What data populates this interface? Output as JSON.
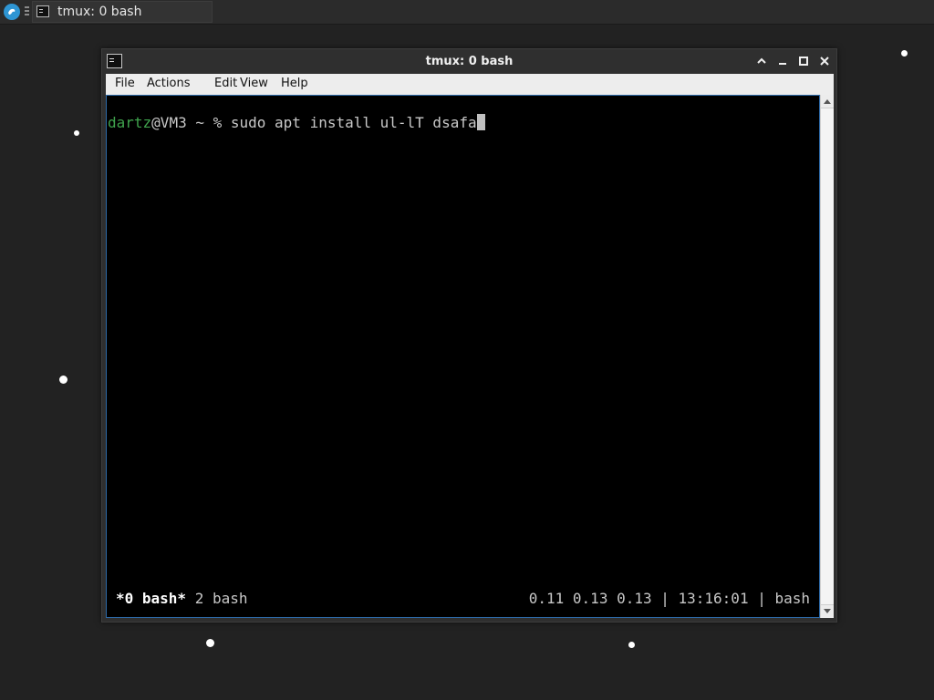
{
  "taskbar": {
    "start_icon": "app-menu-icon",
    "task_icon": "terminal-icon",
    "task_label": "tmux: 0 bash"
  },
  "window": {
    "icon": "terminal-icon",
    "title": "tmux: 0 bash",
    "controls": [
      "chevron-up-icon",
      "minimize-icon",
      "maximize-icon",
      "close-icon"
    ]
  },
  "menu": {
    "file": "File",
    "actions": "Actions",
    "edit": "Edit",
    "view": "View",
    "help": "Help"
  },
  "terminal": {
    "user": "dartz",
    "host_and_path": "@VM3 ~ % ",
    "command": "sudo apt install ul-lT dsafa",
    "user_color": "#3fa34d"
  },
  "tmux_status": {
    "active_window": "*0 bash*",
    "other_windows": " 2 bash",
    "right": "0.11 0.13 0.13 | 13:16:01 | bash"
  },
  "colors": {
    "desktop": "#222222",
    "terminal_bg": "#000000",
    "accent_border": "#2d6aa8",
    "start_button": "#2e95d3"
  }
}
